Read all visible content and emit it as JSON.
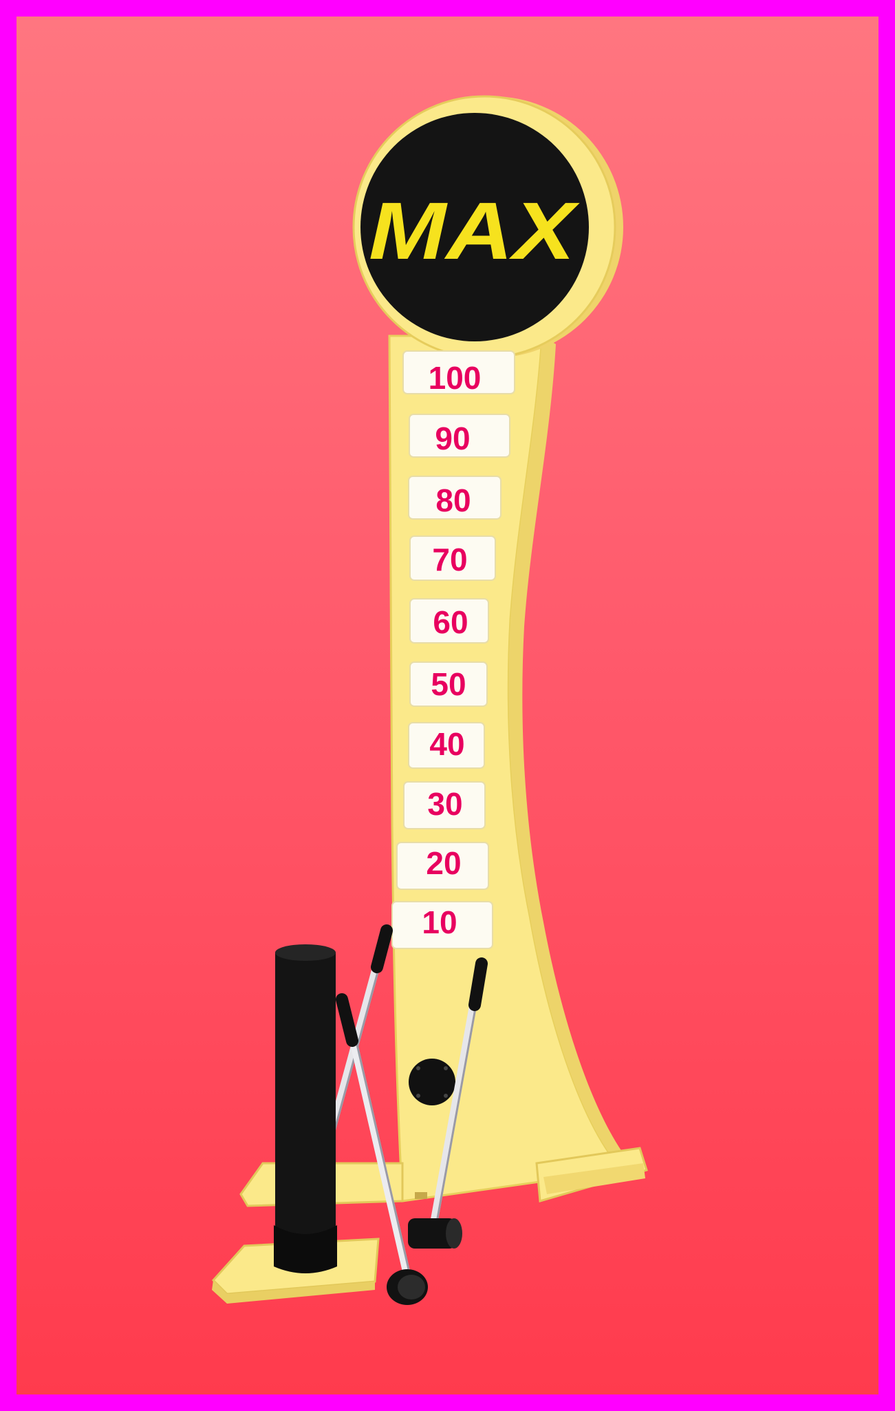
{
  "logo": {
    "text": "MAX"
  },
  "scale": {
    "labels": [
      "100",
      "90",
      "80",
      "70",
      "60",
      "50",
      "40",
      "30",
      "20",
      "10"
    ]
  },
  "colors": {
    "border": "#ff00ff",
    "background_top": "#ff7680",
    "background_bottom": "#ff3b4d",
    "machine_yellow": "#fbe98a",
    "sign_black": "#141414",
    "logo_yellow": "#f6e21e",
    "score_text": "#e8005f"
  }
}
